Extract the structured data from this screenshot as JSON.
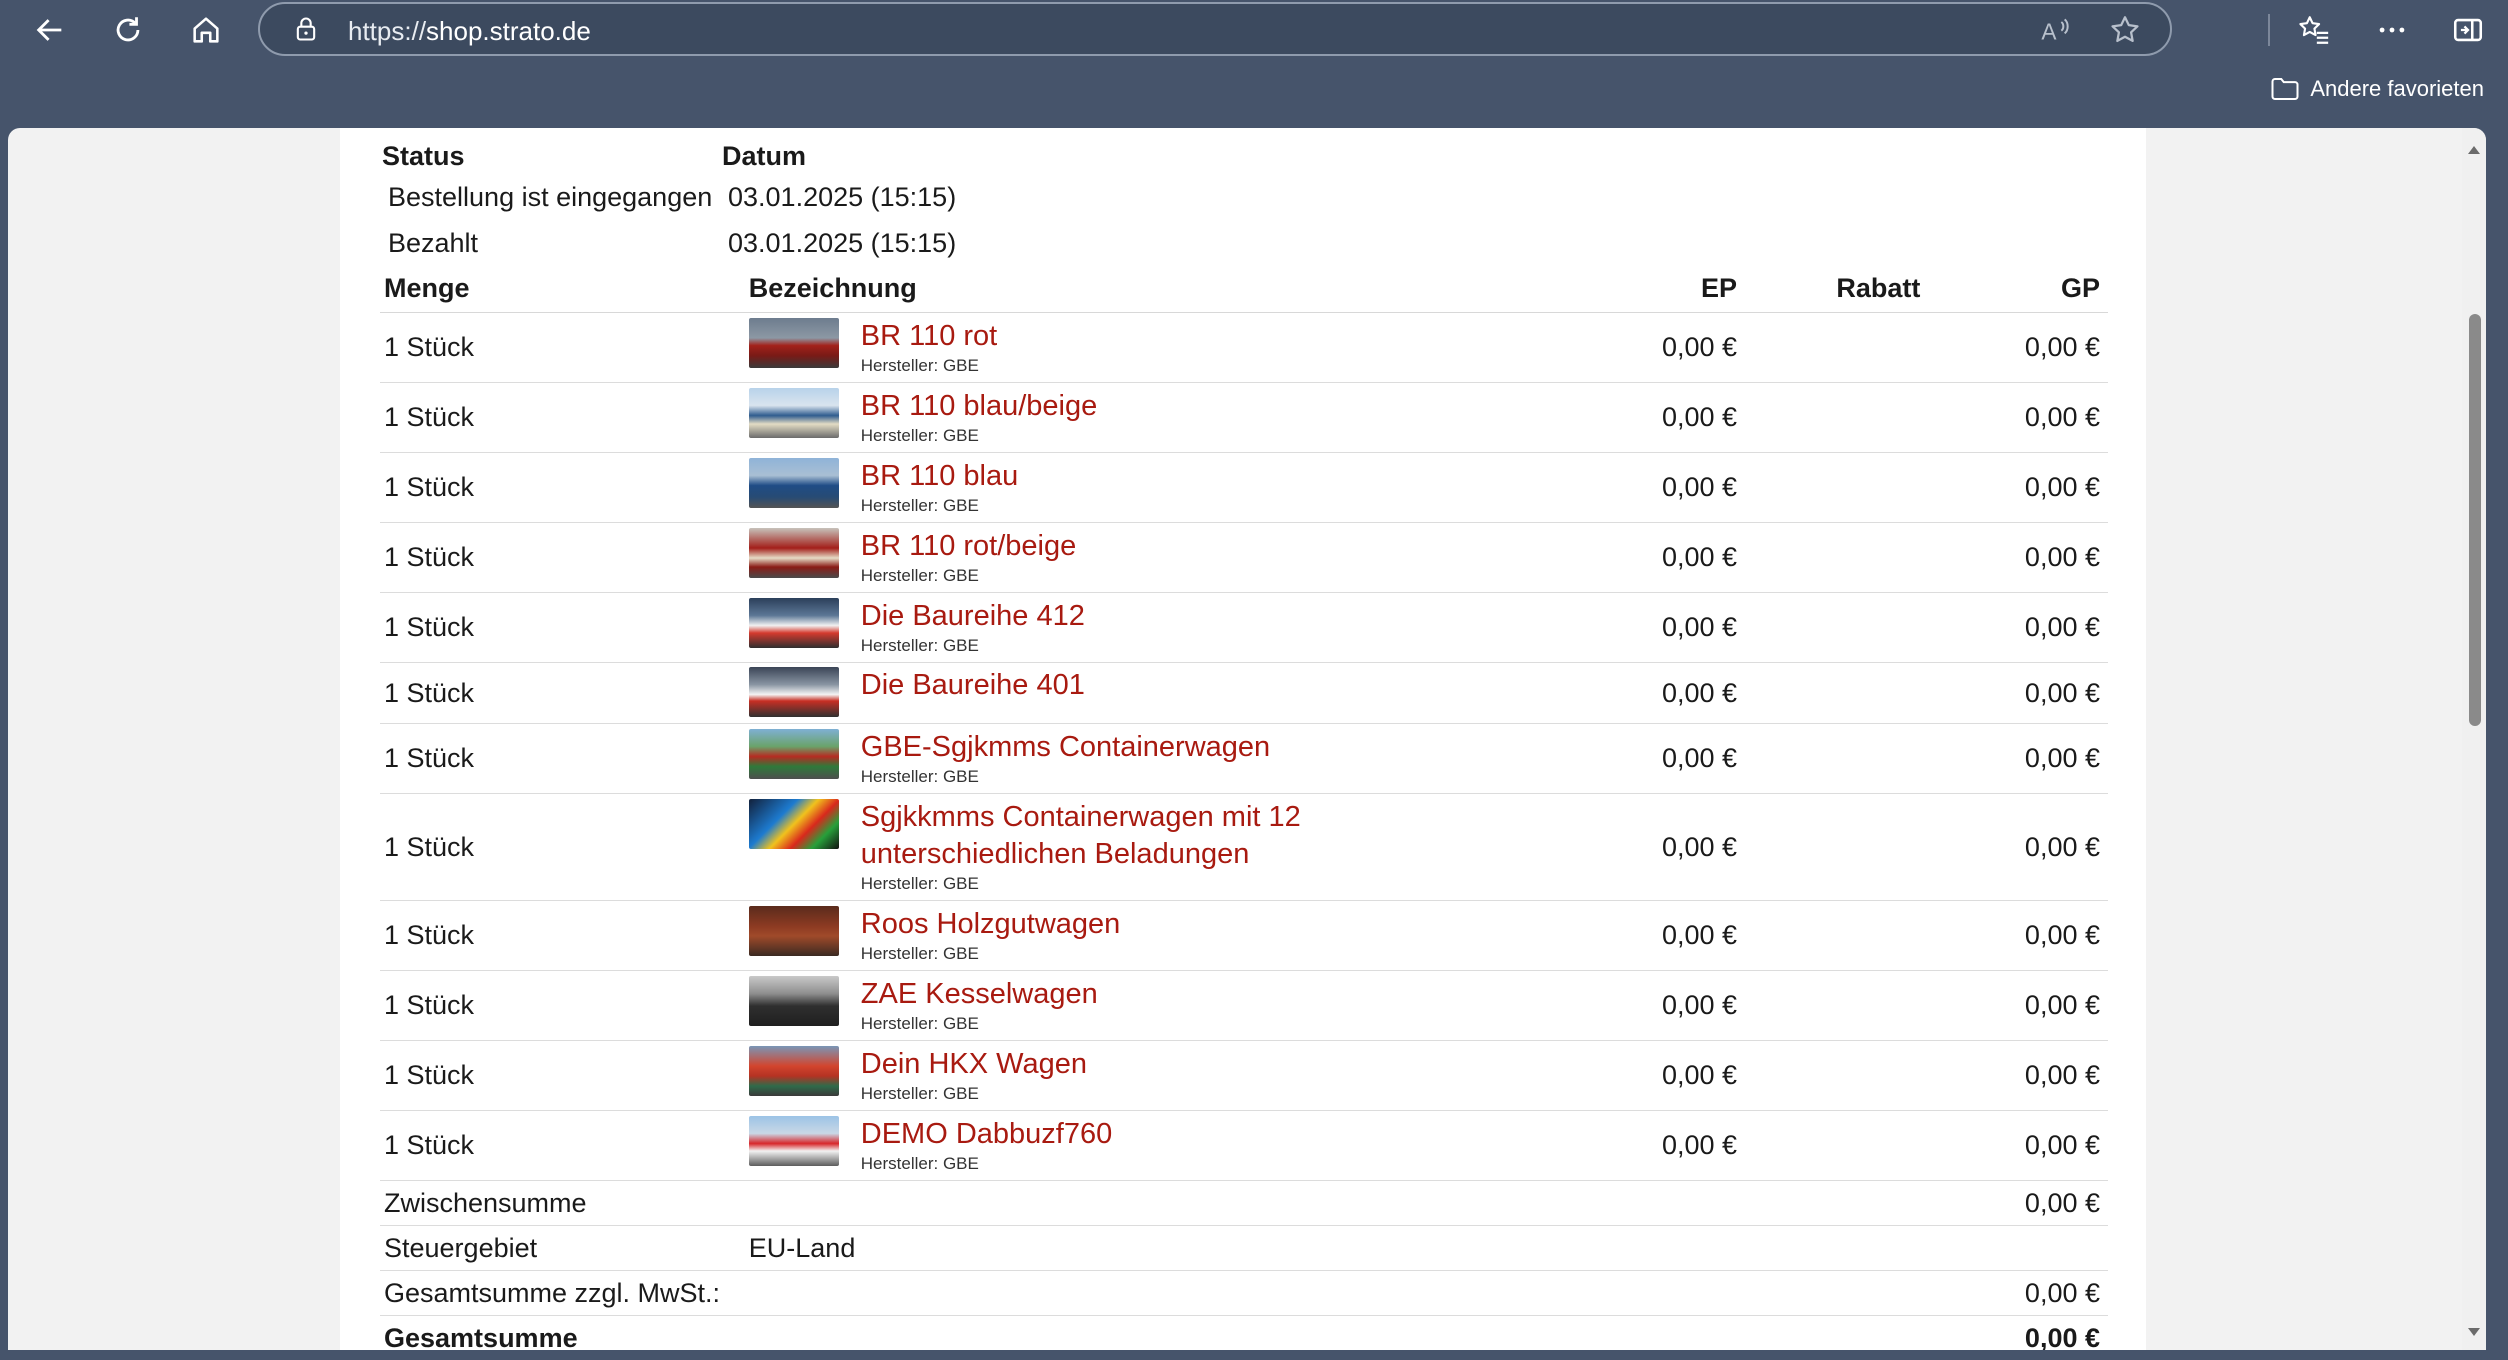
{
  "browser": {
    "url_scheme": "https://",
    "url_host": "shop.strato.de",
    "favorites_folder": "Andere favorieten",
    "colors": {
      "chrome": "#46546b",
      "link": "#a81a10"
    }
  },
  "order": {
    "status_headers": {
      "status": "Status",
      "date": "Datum"
    },
    "status_rows": [
      {
        "status": "Bestellung ist eingegangen",
        "date": "03.01.2025 (15:15)"
      },
      {
        "status": "Bezahlt",
        "date": "03.01.2025 (15:15)"
      }
    ],
    "item_headers": {
      "qty": "Menge",
      "desc": "Bezeichnung",
      "ep": "EP",
      "discount": "Rabatt",
      "gp": "GP"
    },
    "items": [
      {
        "qty": "1 Stück",
        "name": "BR 110 rot",
        "maker": "Hersteller: GBE",
        "ep": "0,00 €",
        "gp": "0,00 €"
      },
      {
        "qty": "1 Stück",
        "name": "BR 110 blau/beige",
        "maker": "Hersteller: GBE",
        "ep": "0,00 €",
        "gp": "0,00 €"
      },
      {
        "qty": "1 Stück",
        "name": "BR 110 blau",
        "maker": "Hersteller: GBE",
        "ep": "0,00 €",
        "gp": "0,00 €"
      },
      {
        "qty": "1 Stück",
        "name": "BR 110 rot/beige",
        "maker": "Hersteller: GBE",
        "ep": "0,00 €",
        "gp": "0,00 €"
      },
      {
        "qty": "1 Stück",
        "name": "Die Baureihe 412",
        "maker": "Hersteller: GBE",
        "ep": "0,00 €",
        "gp": "0,00 €"
      },
      {
        "qty": "1 Stück",
        "name": "Die Baureihe 401",
        "maker": "",
        "ep": "0,00 €",
        "gp": "0,00 €"
      },
      {
        "qty": "1 Stück",
        "name": "GBE-Sgjkmms Containerwagen",
        "maker": "Hersteller: GBE",
        "ep": "0,00 €",
        "gp": "0,00 €"
      },
      {
        "qty": "1 Stück",
        "name": "Sgjkkmms Containerwagen mit 12 unterschiedlichen Beladungen",
        "maker": "Hersteller: GBE",
        "ep": "0,00 €",
        "gp": "0,00 €"
      },
      {
        "qty": "1 Stück",
        "name": "Roos Holzgutwagen",
        "maker": "Hersteller: GBE",
        "ep": "0,00 €",
        "gp": "0,00 €"
      },
      {
        "qty": "1 Stück",
        "name": "ZAE Kesselwagen",
        "maker": "Hersteller: GBE",
        "ep": "0,00 €",
        "gp": "0,00 €"
      },
      {
        "qty": "1 Stück",
        "name": "Dein HKX Wagen",
        "maker": "Hersteller: GBE",
        "ep": "0,00 €",
        "gp": "0,00 €"
      },
      {
        "qty": "1 Stück",
        "name": "DEMO Dabbuzf760",
        "maker": "Hersteller: GBE",
        "ep": "0,00 €",
        "gp": "0,00 €"
      }
    ],
    "summary": {
      "subtotal_label": "Zwischensumme",
      "subtotal_value": "0,00 €",
      "tax_region_label": "Steuergebiet",
      "tax_region_value": "EU-Land",
      "net_total_label": "Gesamtsumme zzgl. MwSt.:",
      "net_total_value": "0,00 €",
      "total_label": "Gesamtsumme",
      "total_value": "0,00 €"
    }
  }
}
